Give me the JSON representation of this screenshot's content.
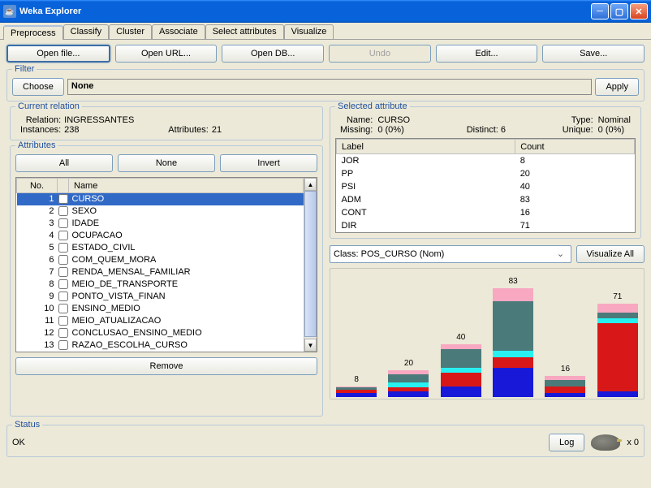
{
  "window": {
    "title": "Weka Explorer"
  },
  "tabs": [
    "Preprocess",
    "Classify",
    "Cluster",
    "Associate",
    "Select attributes",
    "Visualize"
  ],
  "active_tab": 0,
  "toolbar": {
    "open_file": "Open file...",
    "open_url": "Open URL...",
    "open_db": "Open DB...",
    "undo": "Undo",
    "edit": "Edit...",
    "save": "Save..."
  },
  "filter": {
    "title": "Filter",
    "choose": "Choose",
    "value": "None",
    "apply": "Apply"
  },
  "relation": {
    "title": "Current relation",
    "relation_label": "Relation:",
    "relation_value": "INGRESSANTES",
    "instances_label": "Instances:",
    "instances_value": "238",
    "attributes_label": "Attributes:",
    "attributes_value": "21"
  },
  "attributes_panel": {
    "title": "Attributes",
    "all": "All",
    "none": "None",
    "invert": "Invert",
    "col_no": "No.",
    "col_name": "Name",
    "items": [
      {
        "no": 1,
        "name": "CURSO",
        "selected": true
      },
      {
        "no": 2,
        "name": "SEXO"
      },
      {
        "no": 3,
        "name": "IDADE"
      },
      {
        "no": 4,
        "name": "OCUPACAO"
      },
      {
        "no": 5,
        "name": "ESTADO_CIVIL"
      },
      {
        "no": 6,
        "name": "COM_QUEM_MORA"
      },
      {
        "no": 7,
        "name": "RENDA_MENSAL_FAMILIAR"
      },
      {
        "no": 8,
        "name": "MEIO_DE_TRANSPORTE"
      },
      {
        "no": 9,
        "name": "PONTO_VISTA_FINAN"
      },
      {
        "no": 10,
        "name": "ENSINO_MEDIO"
      },
      {
        "no": 11,
        "name": "MEIO_ATUALIZACAO"
      },
      {
        "no": 12,
        "name": "CONCLUSAO_ENSINO_MEDIO"
      },
      {
        "no": 13,
        "name": "RAZAO_ESCOLHA_CURSO"
      }
    ],
    "remove": "Remove"
  },
  "selected_attr": {
    "title": "Selected attribute",
    "name_label": "Name:",
    "name_value": "CURSO",
    "type_label": "Type:",
    "type_value": "Nominal",
    "missing_label": "Missing:",
    "missing_value": "0 (0%)",
    "distinct_label": "Distinct:",
    "distinct_value": "6",
    "unique_label": "Unique:",
    "unique_value": "0 (0%)",
    "col_label": "Label",
    "col_count": "Count",
    "rows": [
      {
        "label": "JOR",
        "count": 8
      },
      {
        "label": "PP",
        "count": 20
      },
      {
        "label": "PSI",
        "count": 40
      },
      {
        "label": "ADM",
        "count": 83
      },
      {
        "label": "CONT",
        "count": 16
      },
      {
        "label": "DIR",
        "count": 71
      }
    ]
  },
  "class_select": {
    "value": "Class: POS_CURSO (Nom)",
    "visualize_all": "Visualize All"
  },
  "chart_data": {
    "type": "bar",
    "categories": [
      "JOR",
      "PP",
      "PSI",
      "ADM",
      "CONT",
      "DIR"
    ],
    "values": [
      8,
      20,
      40,
      83,
      16,
      71
    ],
    "title": "",
    "xlabel": "",
    "ylabel": "",
    "ylim": [
      0,
      83
    ],
    "stacks": [
      {
        "total": 8,
        "segments": [
          {
            "c": "#1818d8",
            "h": 3
          },
          {
            "c": "#d81818",
            "h": 2
          },
          {
            "c": "#4a7a7a",
            "h": 2
          },
          {
            "c": "#f8a8c0",
            "h": 1
          }
        ]
      },
      {
        "total": 20,
        "segments": [
          {
            "c": "#1818d8",
            "h": 4
          },
          {
            "c": "#d81818",
            "h": 3
          },
          {
            "c": "#28f0f0",
            "h": 4
          },
          {
            "c": "#4a7a7a",
            "h": 6
          },
          {
            "c": "#f8a8c0",
            "h": 3
          }
        ]
      },
      {
        "total": 40,
        "segments": [
          {
            "c": "#1818d8",
            "h": 8
          },
          {
            "c": "#d81818",
            "h": 10
          },
          {
            "c": "#28f0f0",
            "h": 4
          },
          {
            "c": "#4a7a7a",
            "h": 14
          },
          {
            "c": "#f8a8c0",
            "h": 4
          }
        ]
      },
      {
        "total": 83,
        "segments": [
          {
            "c": "#1818d8",
            "h": 22
          },
          {
            "c": "#d81818",
            "h": 8
          },
          {
            "c": "#28f0f0",
            "h": 5
          },
          {
            "c": "#4a7a7a",
            "h": 38
          },
          {
            "c": "#f8a8c0",
            "h": 10
          }
        ]
      },
      {
        "total": 16,
        "segments": [
          {
            "c": "#1818d8",
            "h": 3
          },
          {
            "c": "#d81818",
            "h": 5
          },
          {
            "c": "#4a7a7a",
            "h": 5
          },
          {
            "c": "#f8a8c0",
            "h": 3
          }
        ]
      },
      {
        "total": 71,
        "segments": [
          {
            "c": "#1818d8",
            "h": 4
          },
          {
            "c": "#d81818",
            "h": 52
          },
          {
            "c": "#28f0f0",
            "h": 4
          },
          {
            "c": "#4a7a7a",
            "h": 4
          },
          {
            "c": "#f8a8c0",
            "h": 7
          }
        ]
      }
    ]
  },
  "status": {
    "title": "Status",
    "text": "OK",
    "log": "Log",
    "bird_count": "x 0"
  }
}
